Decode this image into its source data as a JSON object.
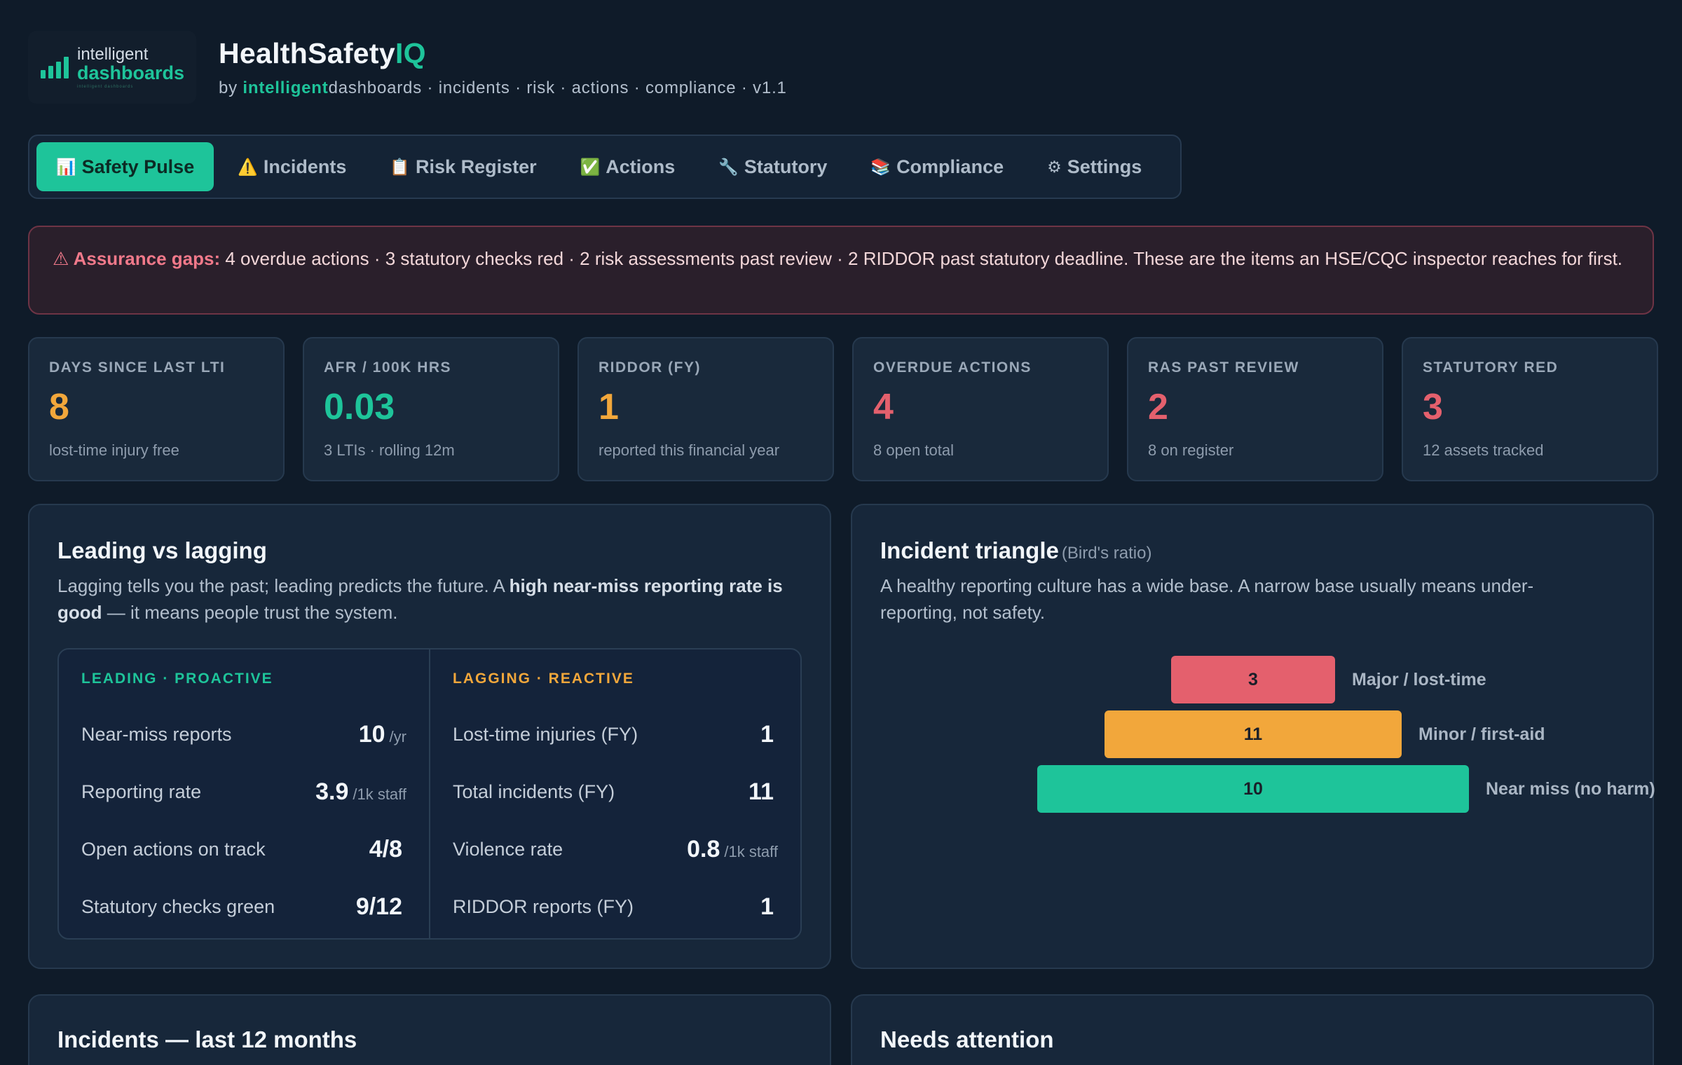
{
  "brand": {
    "logo_top": "intelligent",
    "logo_bottom": "dashboards",
    "logo_fine": "intelligent dashboards",
    "title_main": "HealthSafety",
    "title_accent": "IQ",
    "subtitle_prefix": "by ",
    "subtitle_brand_a": "intelligent",
    "subtitle_brand_b": "dashboards",
    "subtitle_rest": " · incidents · risk · actions · compliance · v1.1"
  },
  "tabs": [
    {
      "icon": "📊",
      "label": "Safety Pulse",
      "active": true
    },
    {
      "icon": "⚠️",
      "label": "Incidents",
      "active": false
    },
    {
      "icon": "📋",
      "label": "Risk Register",
      "active": false
    },
    {
      "icon": "✅",
      "label": "Actions",
      "active": false
    },
    {
      "icon": "🔧",
      "label": "Statutory",
      "active": false
    },
    {
      "icon": "📚",
      "label": "Compliance",
      "active": false
    },
    {
      "icon": "⚙",
      "label": "Settings",
      "active": false
    }
  ],
  "alert": {
    "icon": "⚠",
    "label": "Assurance gaps:",
    "text": "4 overdue actions · 3 statutory checks red · 2 risk assessments past review · 2 RIDDOR past statutory deadline. These are the items an HSE/CQC inspector reaches for first."
  },
  "kpis": [
    {
      "label": "DAYS SINCE LAST LTI",
      "value": "8",
      "sub": "lost-time injury free",
      "color": "#f2a73b"
    },
    {
      "label": "AFR / 100K HRS",
      "value": "0.03",
      "sub": "3 LTIs · rolling 12m",
      "color": "#1ec49a"
    },
    {
      "label": "RIDDOR (FY)",
      "value": "1",
      "sub": "reported this financial year",
      "color": "#f2a73b"
    },
    {
      "label": "OVERDUE ACTIONS",
      "value": "4",
      "sub": "8 open total",
      "color": "#e4606d"
    },
    {
      "label": "RAS PAST REVIEW",
      "value": "2",
      "sub": "8 on register",
      "color": "#e4606d"
    },
    {
      "label": "STATUTORY RED",
      "value": "3",
      "sub": "12 assets tracked",
      "color": "#e4606d"
    }
  ],
  "leading_lagging": {
    "title": "Leading vs lagging",
    "desc_a": "Lagging tells you the past; leading predicts the future. A ",
    "desc_b": "high near-miss reporting rate is good",
    "desc_c": " — it means people trust the system.",
    "leading": {
      "heading": "LEADING · PROACTIVE",
      "rows": [
        {
          "label": "Near-miss reports",
          "value": "10",
          "unit": "/yr"
        },
        {
          "label": "Reporting rate",
          "value": "3.9",
          "unit": "/1k staff"
        },
        {
          "label": "Open actions on track",
          "value": "4/8",
          "unit": ""
        },
        {
          "label": "Statutory checks green",
          "value": "9/12",
          "unit": ""
        }
      ]
    },
    "lagging": {
      "heading": "LAGGING · REACTIVE",
      "rows": [
        {
          "label": "Lost-time injuries (FY)",
          "value": "1",
          "unit": ""
        },
        {
          "label": "Total incidents (FY)",
          "value": "11",
          "unit": ""
        },
        {
          "label": "Violence rate",
          "value": "0.8",
          "unit": "/1k staff"
        },
        {
          "label": "RIDDOR reports (FY)",
          "value": "1",
          "unit": ""
        }
      ]
    }
  },
  "triangle": {
    "title": "Incident triangle",
    "title_note": "(Bird's ratio)",
    "desc": "A healthy reporting culture has a wide base. A narrow base usually means under-reporting, not safety.",
    "levels": [
      {
        "value": "3",
        "label": "Major / lost-time",
        "color": "#e4606d"
      },
      {
        "value": "11",
        "label": "Minor / first-aid",
        "color": "#f2a73b"
      },
      {
        "value": "10",
        "label": "Near miss (no harm)",
        "color": "#1ec49a"
      }
    ]
  },
  "bottom": {
    "left_title": "Incidents — last 12 months",
    "right_title": "Needs attention"
  },
  "colors": {
    "accent": "#1ec49a",
    "amber": "#f2a73b",
    "red": "#e4606d",
    "bg": "#0f1b29"
  }
}
